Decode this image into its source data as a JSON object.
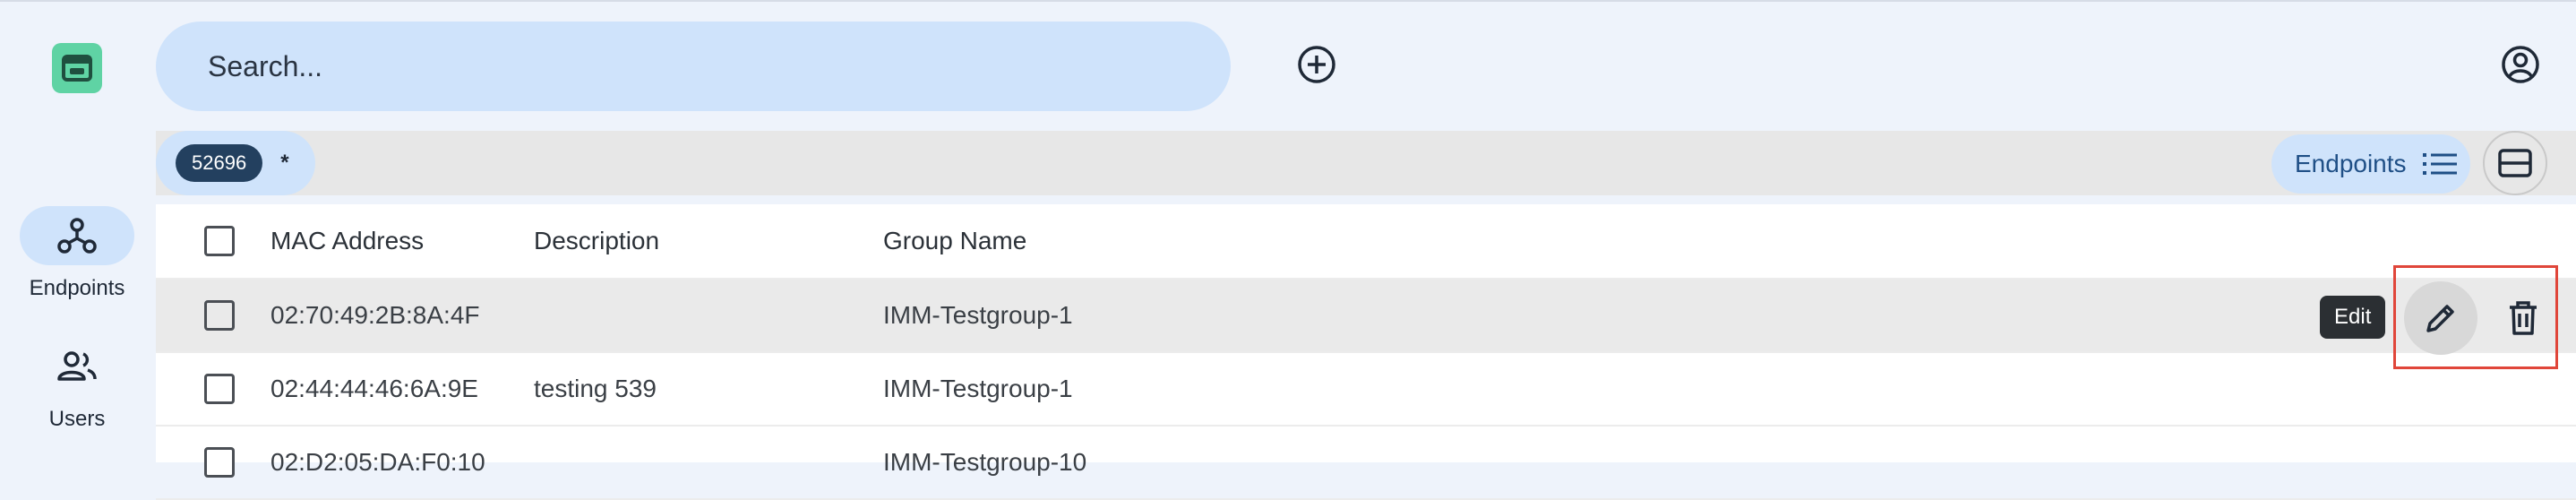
{
  "app": {
    "logo_icon": "app-logo-icon",
    "accent": "#5fd3a4"
  },
  "sidebar": {
    "items": [
      {
        "label": "Endpoints",
        "icon": "endpoints-graph-icon",
        "active": true
      },
      {
        "label": "Users",
        "icon": "users-icon",
        "active": false
      }
    ]
  },
  "topbar": {
    "search_placeholder": "Search...",
    "add_icon": "add-circle-icon",
    "account_icon": "account-circle-icon"
  },
  "filterbar": {
    "chip_label": "52696",
    "star_label": "*",
    "view_label": "Endpoints",
    "view_icon": "list-icon",
    "toggle_icon": "card-view-icon"
  },
  "table": {
    "columns": [
      "MAC Address",
      "Description",
      "Group Name"
    ],
    "rows": [
      {
        "mac": "02:70:49:2B:8A:4F",
        "description": "",
        "group": "IMM-Testgroup-1"
      },
      {
        "mac": "02:44:44:46:6A:9E",
        "description": "testing 539",
        "group": "IMM-Testgroup-1"
      },
      {
        "mac": "02:D2:05:DA:F0:10",
        "description": "",
        "group": "IMM-Testgroup-10"
      }
    ],
    "row_actions": {
      "tooltip": "Edit",
      "edit_icon": "pencil-icon",
      "delete_icon": "trash-icon"
    }
  },
  "colors": {
    "background": "#eef3fb",
    "pill": "#cfe3fb",
    "chip": "#23405f",
    "highlight": "#e0463a"
  }
}
